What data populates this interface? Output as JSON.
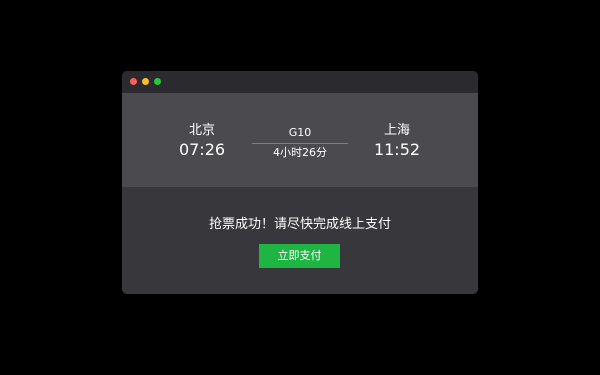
{
  "window": {
    "controls": [
      "close",
      "minimize",
      "maximize"
    ]
  },
  "trip": {
    "departure": {
      "city": "北京",
      "time": "07:26"
    },
    "arrival": {
      "city": "上海",
      "time": "11:52"
    },
    "train_number": "G10",
    "duration": "4小时26分"
  },
  "status": {
    "message": "抢票成功！请尽快完成线上支付",
    "pay_button_label": "立即支付"
  },
  "colors": {
    "page_background": "#000000",
    "window_background": "#38383c",
    "titlebar": "#2b2b2f",
    "trip_panel": "#4b4b4f",
    "route_line": "#3e8ed6",
    "pay_button": "#1fb542",
    "close_dot": "#fd5f57",
    "minimize_dot": "#fdbc2e",
    "maximize_dot": "#28c840"
  }
}
